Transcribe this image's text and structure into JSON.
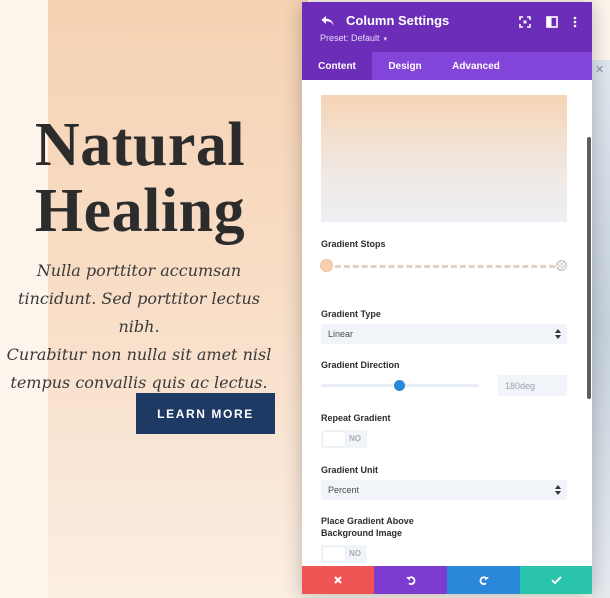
{
  "hero": {
    "title_line1": "Natural",
    "title_line2": "Healing",
    "body_line1": "Nulla porttitor accumsan",
    "body_line2": "tincidunt. Sed porttitor lectus nibh.",
    "body_line3": "Curabitur non nulla sit amet nisl",
    "body_line4": "tempus convallis quis ac lectus.",
    "button_label": "LEARN MORE"
  },
  "panel": {
    "title": "Column Settings",
    "preset": "Preset: Default",
    "tabs": [
      {
        "label": "Content",
        "active": true
      },
      {
        "label": "Design",
        "active": false
      },
      {
        "label": "Advanced",
        "active": false
      }
    ],
    "gradient_stops_label": "Gradient Stops",
    "gradient_type": {
      "label": "Gradient Type",
      "value": "Linear"
    },
    "gradient_direction": {
      "label": "Gradient Direction",
      "value": "180deg",
      "slider_fraction": 0.5
    },
    "repeat_gradient": {
      "label": "Repeat Gradient",
      "toggle": "NO"
    },
    "gradient_unit": {
      "label": "Gradient Unit",
      "value": "Percent"
    },
    "place_above": {
      "label_line1": "Place Gradient Above",
      "label_line2": "Background Image",
      "toggle": "NO"
    }
  },
  "colors": {
    "header_purple": "#6c2eb9",
    "tab_bar_purple": "#8244d9",
    "cancel_red": "#ef5555",
    "undo_purple": "#7e3bd0",
    "redo_blue": "#2b87da",
    "save_green": "#29c4a9",
    "hero_button_navy": "#1e3a64"
  },
  "icons": {
    "back": "undo-arrow-icon",
    "expand": "fullscreen-icon",
    "sidebar": "sidebar-layout-icon",
    "more": "more-vertical-icon",
    "cancel": "close-icon",
    "undo": "undo-icon",
    "redo": "redo-icon",
    "save": "checkmark-icon"
  }
}
